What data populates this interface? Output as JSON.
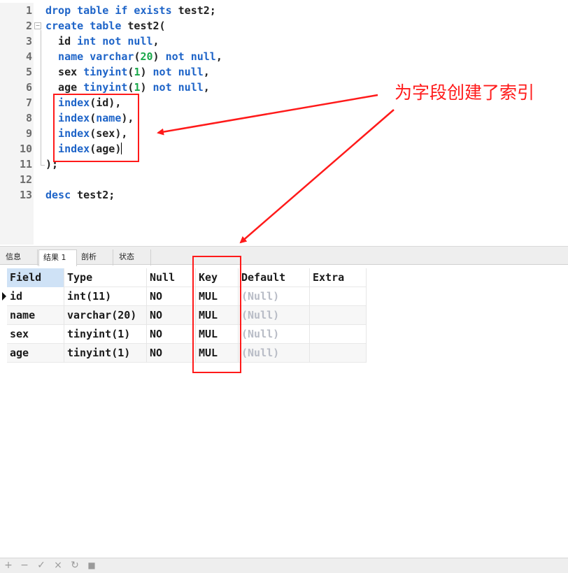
{
  "editor": {
    "line_numbers": [
      "1",
      "2",
      "3",
      "4",
      "5",
      "6",
      "7",
      "8",
      "9",
      "10",
      "11",
      "12",
      "13"
    ],
    "lines": [
      [
        {
          "t": "drop table if exists ",
          "c": "kw"
        },
        {
          "t": "test2;",
          "c": "pl"
        }
      ],
      [
        {
          "t": "create table ",
          "c": "kw"
        },
        {
          "t": "test2(",
          "c": "pl"
        }
      ],
      [
        {
          "t": "  id ",
          "c": "pl"
        },
        {
          "t": "int not null",
          "c": "kw"
        },
        {
          "t": ",",
          "c": "pl"
        }
      ],
      [
        {
          "t": "  name varchar",
          "c": "kw"
        },
        {
          "t": "(",
          "c": "pl"
        },
        {
          "t": "20",
          "c": "num"
        },
        {
          "t": ") ",
          "c": "pl"
        },
        {
          "t": "not null",
          "c": "kw"
        },
        {
          "t": ",",
          "c": "pl"
        }
      ],
      [
        {
          "t": "  sex ",
          "c": "pl"
        },
        {
          "t": "tinyint",
          "c": "kw"
        },
        {
          "t": "(",
          "c": "pl"
        },
        {
          "t": "1",
          "c": "num"
        },
        {
          "t": ") ",
          "c": "pl"
        },
        {
          "t": "not null",
          "c": "kw"
        },
        {
          "t": ",",
          "c": "pl"
        }
      ],
      [
        {
          "t": "  age ",
          "c": "pl"
        },
        {
          "t": "tinyint",
          "c": "kw"
        },
        {
          "t": "(",
          "c": "pl"
        },
        {
          "t": "1",
          "c": "num"
        },
        {
          "t": ") ",
          "c": "pl"
        },
        {
          "t": "not null",
          "c": "kw"
        },
        {
          "t": ",",
          "c": "pl"
        }
      ],
      [
        {
          "t": "  index",
          "c": "kw"
        },
        {
          "t": "(id),",
          "c": "pl"
        }
      ],
      [
        {
          "t": "  index",
          "c": "kw"
        },
        {
          "t": "(",
          "c": "pl"
        },
        {
          "t": "name",
          "c": "kw"
        },
        {
          "t": "),",
          "c": "pl"
        }
      ],
      [
        {
          "t": "  index",
          "c": "kw"
        },
        {
          "t": "(sex),",
          "c": "pl"
        }
      ],
      [
        {
          "t": "  index",
          "c": "kw"
        },
        {
          "t": "(age)",
          "c": "pl"
        }
      ],
      [
        {
          "t": ");",
          "c": "pl"
        }
      ],
      [],
      [
        {
          "t": "desc ",
          "c": "kw"
        },
        {
          "t": "test2;",
          "c": "pl"
        }
      ]
    ],
    "annotation": "为字段创建了索引"
  },
  "tabs": [
    {
      "label": "信息",
      "active": false
    },
    {
      "label": "结果 1",
      "active": true
    },
    {
      "label": "剖析",
      "active": false
    },
    {
      "label": "状态",
      "active": false
    }
  ],
  "grid": {
    "columns": [
      "Field",
      "Type",
      "Null",
      "Key",
      "Default",
      "Extra"
    ],
    "rows": [
      [
        "id",
        "int(11)",
        "NO",
        "MUL",
        "(Null)",
        ""
      ],
      [
        "name",
        "varchar(20)",
        "NO",
        "MUL",
        "(Null)",
        ""
      ],
      [
        "sex",
        "tinyint(1)",
        "NO",
        "MUL",
        "(Null)",
        ""
      ],
      [
        "age",
        "tinyint(1)",
        "NO",
        "MUL",
        "(Null)",
        ""
      ]
    ]
  },
  "toolbar": {
    "add": "+",
    "remove": "−",
    "apply": "✓",
    "discard": "×",
    "refresh": "↻",
    "stop": "■"
  },
  "colors": {
    "keyword": "#1e64c8",
    "number": "#19a84a",
    "annotation": "#ff1a1a",
    "null_value": "#b8bcc6",
    "header_highlight": "#cfe2f6"
  }
}
